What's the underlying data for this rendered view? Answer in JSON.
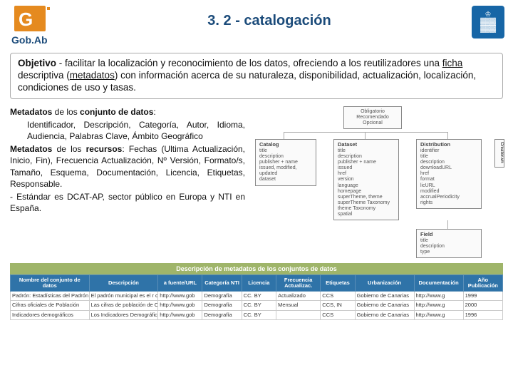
{
  "header": {
    "logo_text": "Gob.Ab",
    "title": "3. 2 - catalogación"
  },
  "objective": {
    "label": "Objetivo",
    "text_parts": {
      "p1": " - facilitar la localización y reconocimiento de los datos, ofreciendo a los reutilizadores una ",
      "ficha": "ficha",
      "p2": " descriptiva (",
      "meta": "metadatos",
      "p3": ") con información acerca de su naturaleza, disponibilidad, actualización, localización, condiciones de uso y tasas."
    }
  },
  "metadata": {
    "dataset_label": "Metadatos",
    "dataset_mid": " de los ",
    "dataset_bold2": "conjunto de datos",
    "dataset_body": "Identificador, Descripción, Categoría, Autor, Idioma, Audiencia, Palabras Clave, Ámbito Geográfico",
    "resources_label": "Metadatos",
    "resources_mid": " de los ",
    "resources_bold2": "recursos",
    "resources_body": ": Fechas (Ultima Actualización, Inicio, Fin), Frecuencia Actualización, Nº Versión, Formato/s, Tamaño, Esquema, Documentación, Licencia, Etiquetas, Responsable.",
    "standard": "- Estándar es DCAT-AP, sector público en Europa y NTI en España."
  },
  "diagram": {
    "top_label": "Obligatorio\nRecomendado\nOpcional",
    "catalog": {
      "title": "Catalog",
      "items": [
        "title",
        "description",
        "publisher + name",
        "issued, modified, updated",
        "dataset"
      ]
    },
    "dataset": {
      "title": "Dataset",
      "items": [
        "title",
        "description",
        "publisher + name",
        "issued",
        "href",
        "version",
        "language",
        "homepage",
        "superTheme, theme",
        "superTheme Taxonomy",
        "theme Taxonomy",
        "spatial"
      ]
    },
    "distribution": {
      "title": "Distribution",
      "items": [
        "identifier",
        "title",
        "description",
        "downloadURL",
        "href",
        "format",
        "licURL",
        "modified",
        "accrualPeriodicity",
        "rights"
      ]
    },
    "creator": {
      "title": "Creator.vn"
    },
    "field": {
      "title": "Field",
      "items": [
        "title",
        "description",
        "type"
      ]
    }
  },
  "table": {
    "caption": "Descripción de metadatos de los conjuntos de datos",
    "headers": [
      "Nombre del conjunto de datos",
      "Descripción",
      "a fuente/URL",
      "Categoría NTI",
      "Licencia",
      "Frecuencia Actualizac.",
      "Etiquetas",
      "Urbanización",
      "Documentación",
      "Año Publicación"
    ],
    "rows": [
      [
        "Padrón: Estadísticas del Padrón Munic",
        "El padrón municipal es el r chel",
        "http://www.gob",
        "Demografía",
        "CC. BY",
        "Actualizado",
        "CCS",
        "Gobierno de Canarias",
        "http://www.g",
        "1999"
      ],
      [
        "Cifras oficiales de Población",
        "Las cifras de población de C",
        "http://www.gob",
        "Demografía",
        "CC. BY",
        "Mensual",
        "CCS, IN",
        "Gobierno de Canarias",
        "http://www.g",
        "2000"
      ],
      [
        "Indicadores demográficos",
        "Los Indicadores Demográficos es",
        "http://www.gob",
        "Demografía",
        "CC. BY",
        "",
        "CCS",
        "Gobierno de Canarias",
        "http://www.g",
        "1996"
      ]
    ]
  }
}
